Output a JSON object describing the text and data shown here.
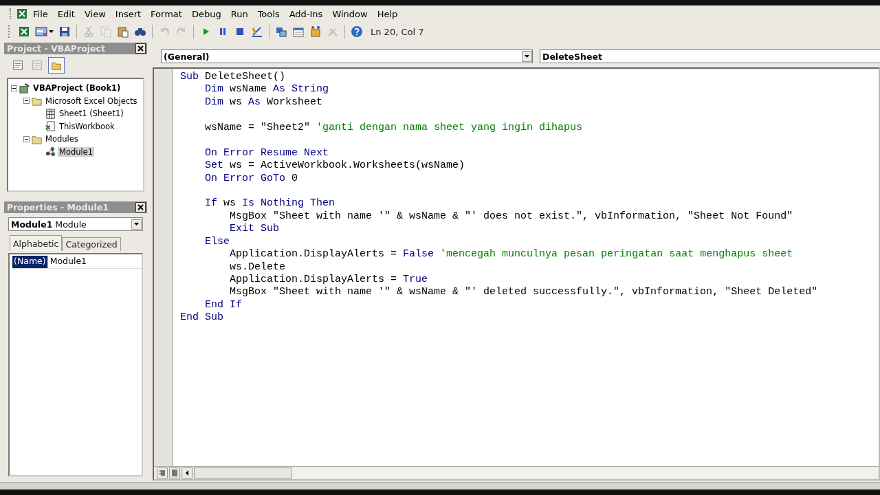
{
  "menu": [
    {
      "label": "File"
    },
    {
      "label": "Edit"
    },
    {
      "label": "View"
    },
    {
      "label": "Insert"
    },
    {
      "label": "Format"
    },
    {
      "label": "Debug"
    },
    {
      "label": "Run"
    },
    {
      "label": "Tools"
    },
    {
      "label": "Add-Ins"
    },
    {
      "label": "Window"
    },
    {
      "label": "Help"
    }
  ],
  "toolbar": {
    "buttons": [
      {
        "kind": "excel",
        "disabled": false
      },
      {
        "kind": "userform",
        "disabled": false
      },
      {
        "kind": "save",
        "disabled": false
      },
      {
        "kind": "sep"
      },
      {
        "kind": "cut",
        "disabled": true
      },
      {
        "kind": "copy",
        "disabled": true
      },
      {
        "kind": "paste",
        "disabled": false
      },
      {
        "kind": "find",
        "disabled": false
      },
      {
        "kind": "sep"
      },
      {
        "kind": "undo",
        "disabled": true
      },
      {
        "kind": "redo",
        "disabled": true
      },
      {
        "kind": "sep"
      },
      {
        "kind": "run",
        "disabled": false
      },
      {
        "kind": "pause",
        "disabled": false
      },
      {
        "kind": "stop",
        "disabled": false
      },
      {
        "kind": "design",
        "disabled": false
      },
      {
        "kind": "sep"
      },
      {
        "kind": "explorer",
        "disabled": false
      },
      {
        "kind": "properties",
        "disabled": false
      },
      {
        "kind": "browser",
        "disabled": false
      },
      {
        "kind": "toolbox",
        "disabled": true
      },
      {
        "kind": "sep"
      },
      {
        "kind": "help",
        "disabled": false
      }
    ],
    "position": "Ln 20, Col 7"
  },
  "project": {
    "title": "Project - VBAProject",
    "view_buttons": [
      {
        "kind": "code",
        "selected": false
      },
      {
        "kind": "object",
        "selected": false
      },
      {
        "kind": "folders",
        "selected": true
      }
    ],
    "tree": [
      {
        "label": "VBAProject (Book1)",
        "kind": "project",
        "expanded": true,
        "selected": false,
        "children": [
          {
            "label": "Microsoft Excel Objects",
            "kind": "folder",
            "expanded": true,
            "selected": false,
            "children": [
              {
                "label": "Sheet1 (Sheet1)",
                "kind": "sheet",
                "selected": false
              },
              {
                "label": "ThisWorkbook",
                "kind": "workbook",
                "selected": false
              }
            ]
          },
          {
            "label": "Modules",
            "kind": "folder",
            "expanded": true,
            "selected": false,
            "children": [
              {
                "label": "Module1",
                "kind": "module",
                "selected": true
              }
            ]
          }
        ]
      }
    ]
  },
  "properties": {
    "title": "Properties - Module1",
    "object": {
      "name": "Module1",
      "type": "Module"
    },
    "tabs": [
      {
        "label": "Alphabetic",
        "selected": true
      },
      {
        "label": "Categorized",
        "selected": false
      }
    ],
    "rows": [
      {
        "name": "(Name)",
        "value": "Module1",
        "selected": true
      }
    ]
  },
  "code": {
    "object": "(General)",
    "procedure": "DeleteSheet",
    "lines": [
      {
        "kind": "code",
        "tokens": [
          {
            "kind": "kw",
            "text": "Sub"
          },
          {
            "kind": "text",
            "text": " DeleteSheet()"
          }
        ]
      },
      {
        "kind": "code",
        "tokens": [
          {
            "kind": "kw",
            "text": "    Dim"
          },
          {
            "kind": "text",
            "text": " wsName "
          },
          {
            "kind": "kw",
            "text": "As String"
          }
        ]
      },
      {
        "kind": "code",
        "tokens": [
          {
            "kind": "kw",
            "text": "    Dim"
          },
          {
            "kind": "text",
            "text": " ws "
          },
          {
            "kind": "kw",
            "text": "As"
          },
          {
            "kind": "text",
            "text": " Worksheet"
          }
        ]
      },
      {
        "kind": "blank"
      },
      {
        "kind": "code",
        "tokens": [
          {
            "kind": "text",
            "text": "    wsName = \"Sheet2\" "
          },
          {
            "kind": "comment",
            "text": "'ganti dengan nama sheet yang ingin dihapus"
          }
        ]
      },
      {
        "kind": "blank"
      },
      {
        "kind": "code",
        "tokens": [
          {
            "kind": "kw",
            "text": "    On Error Resume Next"
          }
        ]
      },
      {
        "kind": "code",
        "tokens": [
          {
            "kind": "kw",
            "text": "    Set"
          },
          {
            "kind": "text",
            "text": " ws = ActiveWorkbook.Worksheets(wsName)"
          }
        ]
      },
      {
        "kind": "code",
        "tokens": [
          {
            "kind": "kw",
            "text": "    On Error GoTo"
          },
          {
            "kind": "text",
            "text": " 0"
          }
        ]
      },
      {
        "kind": "blank"
      },
      {
        "kind": "code",
        "tokens": [
          {
            "kind": "kw",
            "text": "    If"
          },
          {
            "kind": "text",
            "text": " ws "
          },
          {
            "kind": "kw",
            "text": "Is Nothing Then"
          }
        ]
      },
      {
        "kind": "code",
        "tokens": [
          {
            "kind": "text",
            "text": "        MsgBox \"Sheet with name '\" & wsName & \"' does not exist.\", vbInformation, \"Sheet Not Found\""
          }
        ]
      },
      {
        "kind": "code",
        "tokens": [
          {
            "kind": "kw",
            "text": "        Exit Sub"
          }
        ]
      },
      {
        "kind": "code",
        "tokens": [
          {
            "kind": "kw",
            "text": "    Else"
          }
        ]
      },
      {
        "kind": "code",
        "tokens": [
          {
            "kind": "text",
            "text": "        Application.DisplayAlerts = "
          },
          {
            "kind": "kw",
            "text": "False"
          },
          {
            "kind": "comment",
            "text": " 'mencegah munculnya pesan peringatan saat menghapus sheet"
          }
        ]
      },
      {
        "kind": "code",
        "tokens": [
          {
            "kind": "text",
            "text": "        ws.Delete"
          }
        ]
      },
      {
        "kind": "code",
        "tokens": [
          {
            "kind": "text",
            "text": "        Application.DisplayAlerts = "
          },
          {
            "kind": "kw",
            "text": "True"
          }
        ]
      },
      {
        "kind": "code",
        "tokens": [
          {
            "kind": "text",
            "text": "        MsgBox \"Sheet with name '\" & wsName & \"' deleted successfully.\", vbInformation, \"Sheet Deleted\""
          }
        ]
      },
      {
        "kind": "code",
        "tokens": [
          {
            "kind": "kw",
            "text": "    End If"
          }
        ]
      },
      {
        "kind": "code",
        "tokens": [
          {
            "kind": "kw",
            "text": "End Sub"
          }
        ]
      }
    ]
  }
}
